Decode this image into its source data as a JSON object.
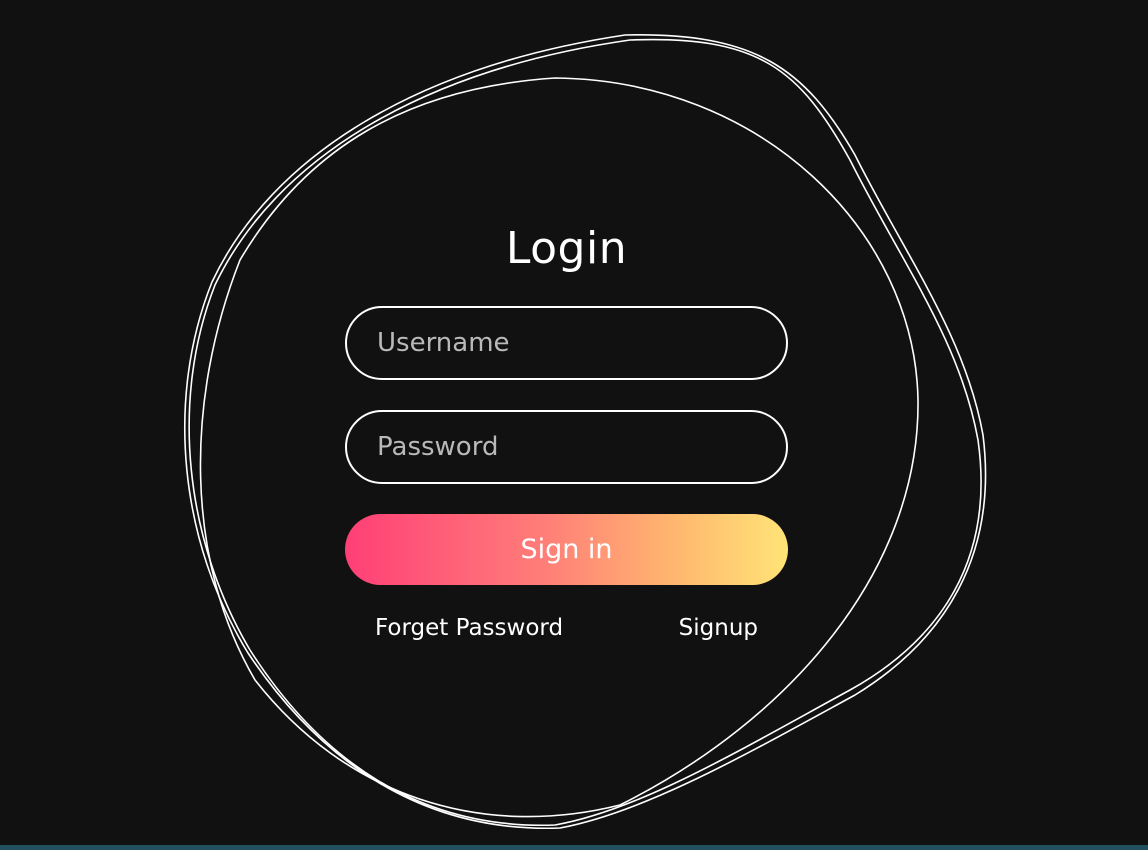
{
  "login": {
    "title": "Login",
    "username": {
      "placeholder": "Username",
      "value": ""
    },
    "password": {
      "placeholder": "Password",
      "value": ""
    },
    "signin_label": "Sign in",
    "forget_password_label": "Forget Password",
    "signup_label": "Signup"
  },
  "theme": {
    "background": "#111111",
    "ring_color": "#ffffff",
    "button_gradient": [
      "#ff3f77",
      "#ff7e78",
      "#ffb86f",
      "#ffe477"
    ]
  }
}
